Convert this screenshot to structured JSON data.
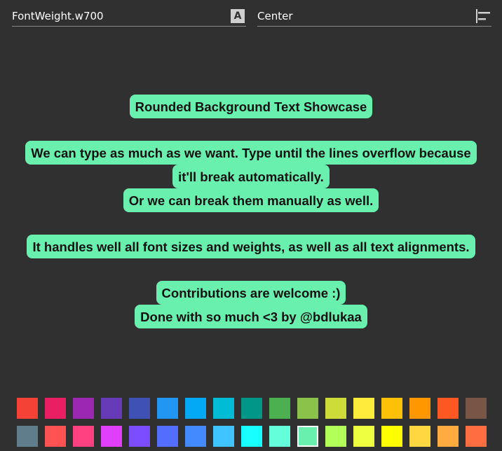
{
  "toolbar": {
    "font_weight": "FontWeight.w700",
    "font_weight_icon": "font-glyph-A",
    "font_weight_icon_text": "A",
    "alignment": "Center",
    "alignment_icon": "align-left-icon"
  },
  "paragraphs": [
    [
      "Rounded Background Text Showcase"
    ],
    [
      "We can type as much as we want. Type until the lines overflow because",
      "it'll break automatically.",
      "Or we can break them manually as well."
    ],
    [
      "It handles well all font sizes and weights, as well as all text alignments."
    ],
    [
      "Contributions are welcome :)",
      "Done with so much <3 by @bdlukaa"
    ]
  ],
  "highlight_color": "#69f0ae",
  "palette": {
    "rows": [
      [
        "#f44336",
        "#e91e63",
        "#9c27b0",
        "#673ab7",
        "#3f51b5",
        "#2196f3",
        "#03a9f4",
        "#00bcd4",
        "#009688",
        "#4caf50",
        "#8bc34a",
        "#cddc39",
        "#ffeb3b",
        "#ffc107",
        "#ff9800",
        "#ff5722",
        "#795548"
      ],
      [
        "#607d8b",
        "#ff5252",
        "#ff4081",
        "#e040fb",
        "#7c4dff",
        "#536dfe",
        "#448aff",
        "#40c4ff",
        "#18ffff",
        "#64ffda",
        "#69f0ae",
        "#b2ff59",
        "#eeff41",
        "#ffff00",
        "#ffd740",
        "#ffab40",
        "#ff6e40"
      ]
    ],
    "selected": "#69f0ae"
  }
}
